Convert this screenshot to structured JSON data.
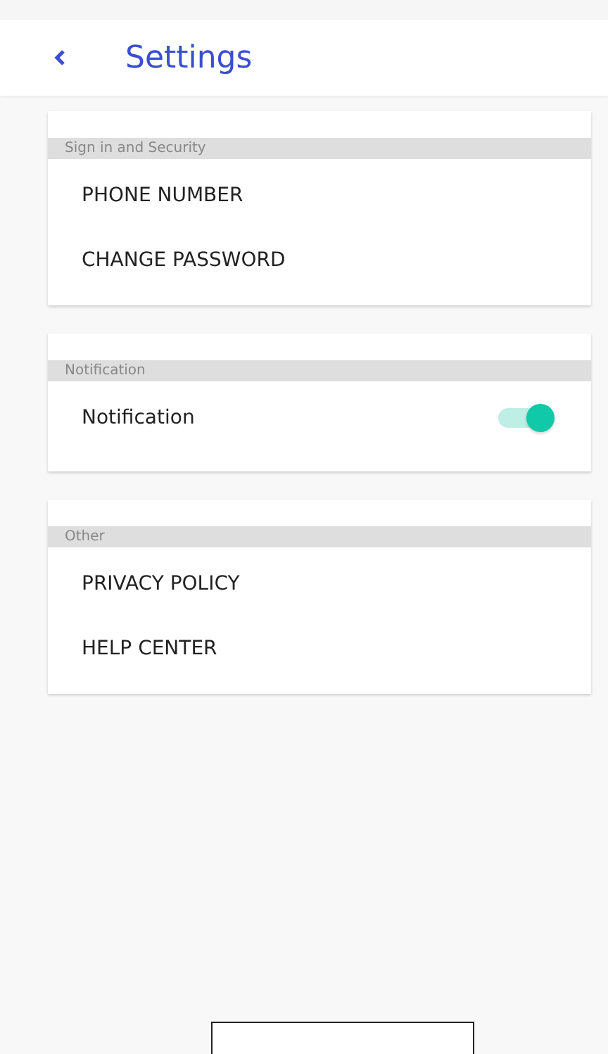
{
  "header": {
    "title": "Settings"
  },
  "sections": [
    {
      "title": "Sign in and Security",
      "items": [
        {
          "kind": "link",
          "label": "PHONE NUMBER"
        },
        {
          "kind": "link",
          "label": "CHANGE PASSWORD"
        }
      ]
    },
    {
      "title": "Notification",
      "items": [
        {
          "kind": "toggle",
          "label": "Notification",
          "on": true
        }
      ]
    },
    {
      "title": "Other",
      "items": [
        {
          "kind": "link",
          "label": "PRIVACY POLICY"
        },
        {
          "kind": "link",
          "label": "HELP CENTER"
        }
      ]
    }
  ]
}
